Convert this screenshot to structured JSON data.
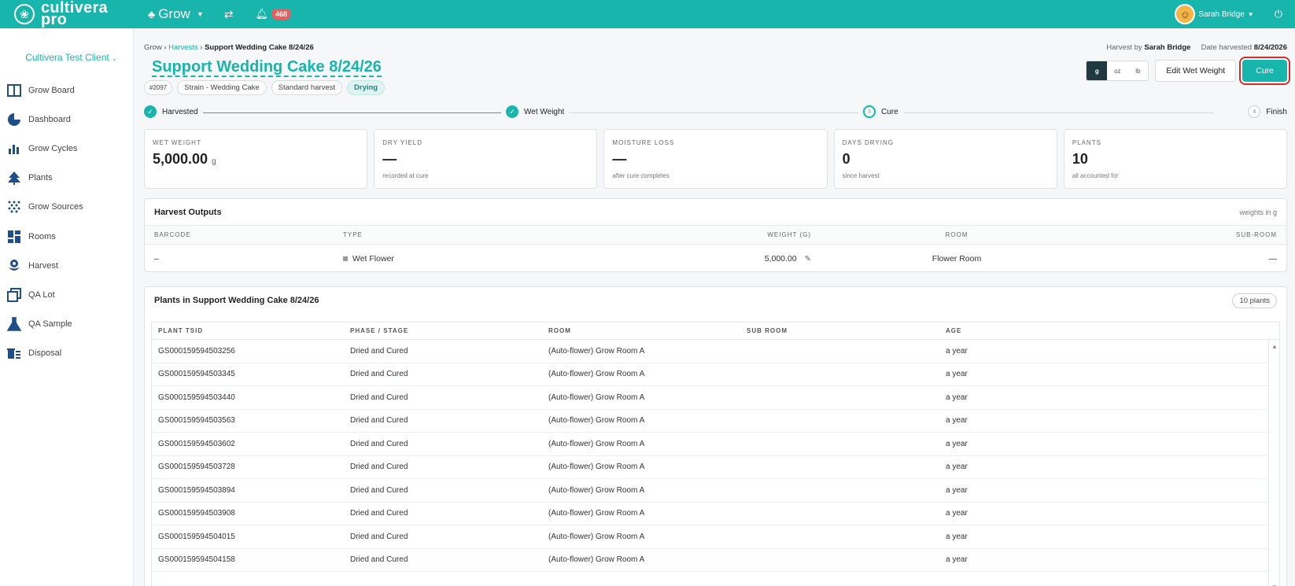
{
  "topbar": {
    "logo_text": "cultivera pro",
    "logo_line1": "cultivera",
    "logo_line2": "pro",
    "module": "Grow",
    "notifications_count": "468",
    "user_name": "Sarah Bridge",
    "icons": [
      "logo-icon",
      "tree-icon",
      "swap-icon",
      "bell-icon",
      "avatar",
      "power-icon"
    ]
  },
  "sidebar": {
    "client": "Cultivera Test Client",
    "items": [
      {
        "label": "Grow Board",
        "icon": "board-icon"
      },
      {
        "label": "Dashboard",
        "icon": "pie-chart-icon"
      },
      {
        "label": "Grow Cycles",
        "icon": "bar-chart-icon"
      },
      {
        "label": "Plants",
        "icon": "tree-icon"
      },
      {
        "label": "Grow Sources",
        "icon": "dots-icon"
      },
      {
        "label": "Rooms",
        "icon": "rooms-icon"
      },
      {
        "label": "Harvest",
        "icon": "flower-icon"
      },
      {
        "label": "QA Lot",
        "icon": "copy-icon"
      },
      {
        "label": "QA Sample",
        "icon": "flask-icon"
      },
      {
        "label": "Disposal",
        "icon": "disposal-icon"
      }
    ]
  },
  "breadcrumb": {
    "root": "Grow",
    "sep": "›",
    "link": "Harvests",
    "current": "Support Wedding Cake 8/24/26"
  },
  "meta": {
    "harvest_by_label": "Harvest by",
    "harvest_by": "Sarah Bridge",
    "date_label": "Date harvested",
    "date": "8/24/2026"
  },
  "title": "Support Wedding Cake 8/24/26",
  "tags": {
    "id": "#2097",
    "strain": "Strain - Wedding Cake",
    "type": "Standard harvest",
    "status": "Drying"
  },
  "units": {
    "g": "g",
    "oz": "oz",
    "lb": "lb",
    "selected": "g"
  },
  "buttons": {
    "edit_wet_weight": "Edit Wet Weight",
    "cure": "Cure"
  },
  "steps": [
    {
      "label": "Harvested",
      "state": "done",
      "marker": "✓"
    },
    {
      "label": "Wet Weight",
      "state": "done",
      "marker": "✓"
    },
    {
      "label": "Cure",
      "state": "current",
      "marker": "3"
    },
    {
      "label": "Finish",
      "state": "todo",
      "marker": "4"
    }
  ],
  "stats": [
    {
      "label": "WET WEIGHT",
      "value": "5,000.00",
      "unit": "g",
      "sub": ""
    },
    {
      "label": "DRY YIELD",
      "value": "—",
      "unit": "",
      "sub": "recorded at cure"
    },
    {
      "label": "MOISTURE LOSS",
      "value": "—",
      "unit": "",
      "sub": "after cure completes"
    },
    {
      "label": "DAYS DRYING",
      "value": "0",
      "unit": "",
      "sub": "since harvest"
    },
    {
      "label": "PLANTS",
      "value": "10",
      "unit": "",
      "sub": "all accounted for"
    }
  ],
  "outputs": {
    "title": "Harvest Outputs",
    "note": "weights in g",
    "columns": {
      "barcode": "BARCODE",
      "type": "TYPE",
      "weight": "WEIGHT (G)",
      "room": "ROOM",
      "sub_room": "SUB-ROOM"
    },
    "row": {
      "barcode": "–",
      "type": "Wet Flower",
      "weight": "5,000.00",
      "room": "Flower Room",
      "sub_room": "—"
    }
  },
  "plants": {
    "title": "Plants in Support Wedding Cake 8/24/26",
    "count": "10 plants",
    "columns": {
      "tsid": "PLANT TSID",
      "phase": "PHASE / STAGE",
      "room": "ROOM",
      "sub_room": "SUB ROOM",
      "age": "AGE"
    },
    "rows": [
      {
        "tsid": "GS000159594503256",
        "phase": "Dried and Cured",
        "room": "(Auto-flower) Grow Room A",
        "sub_room": "",
        "age": "a year"
      },
      {
        "tsid": "GS000159594503345",
        "phase": "Dried and Cured",
        "room": "(Auto-flower) Grow Room A",
        "sub_room": "",
        "age": "a year"
      },
      {
        "tsid": "GS000159594503440",
        "phase": "Dried and Cured",
        "room": "(Auto-flower) Grow Room A",
        "sub_room": "",
        "age": "a year"
      },
      {
        "tsid": "GS000159594503563",
        "phase": "Dried and Cured",
        "room": "(Auto-flower) Grow Room A",
        "sub_room": "",
        "age": "a year"
      },
      {
        "tsid": "GS000159594503602",
        "phase": "Dried and Cured",
        "room": "(Auto-flower) Grow Room A",
        "sub_room": "",
        "age": "a year"
      },
      {
        "tsid": "GS000159594503728",
        "phase": "Dried and Cured",
        "room": "(Auto-flower) Grow Room A",
        "sub_room": "",
        "age": "a year"
      },
      {
        "tsid": "GS000159594503894",
        "phase": "Dried and Cured",
        "room": "(Auto-flower) Grow Room A",
        "sub_room": "",
        "age": "a year"
      },
      {
        "tsid": "GS000159594503908",
        "phase": "Dried and Cured",
        "room": "(Auto-flower) Grow Room A",
        "sub_room": "",
        "age": "a year"
      },
      {
        "tsid": "GS000159594504015",
        "phase": "Dried and Cured",
        "room": "(Auto-flower) Grow Room A",
        "sub_room": "",
        "age": "a year"
      },
      {
        "tsid": "GS000159594504158",
        "phase": "Dried and Cured",
        "room": "(Auto-flower) Grow Room A",
        "sub_room": "",
        "age": "a year"
      }
    ]
  },
  "colors": {
    "brand": "#17b5ab",
    "badge": "#e85d5d",
    "highlight": "#d62b2b"
  }
}
